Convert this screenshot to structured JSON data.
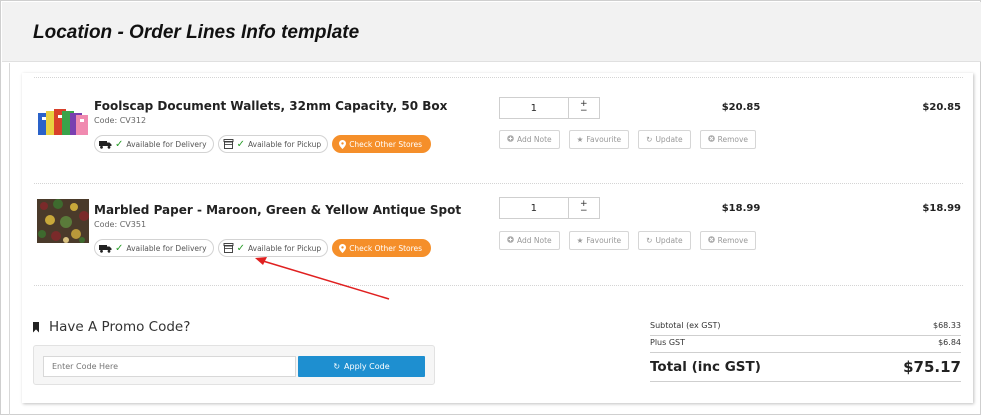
{
  "page": {
    "title": "Location - Order Lines Info template"
  },
  "colors": {
    "accent_orange": "#f58f2a",
    "apply_blue": "#1e8fd0",
    "tick_green": "#2a9d2a",
    "annotation_red": "#e02020"
  },
  "order_lines": [
    {
      "name": "Foolscap Document Wallets, 32mm Capacity, 50 Box",
      "code": "Code: CV312",
      "thumb_icon": "document-wallets-image",
      "delivery_label": "Available for Delivery",
      "pickup_label": "Available for Pickup",
      "stores_label": "Check Other Stores",
      "quantity": "1",
      "unit_price": "$20.85",
      "line_total": "$20.85",
      "actions": {
        "add_note": "Add Note",
        "favourite": "Favourite",
        "update": "Update",
        "remove": "Remove"
      }
    },
    {
      "name": "Marbled Paper - Maroon, Green & Yellow Antique Spot",
      "code": "Code: CV351",
      "thumb_icon": "marbled-paper-image",
      "delivery_label": "Available for Delivery",
      "pickup_label": "Available for Pickup",
      "stores_label": "Check Other Stores",
      "quantity": "1",
      "unit_price": "$18.99",
      "line_total": "$18.99",
      "actions": {
        "add_note": "Add Note",
        "favourite": "Favourite",
        "update": "Update",
        "remove": "Remove"
      }
    }
  ],
  "promo": {
    "title": "Have A Promo Code?",
    "placeholder": "Enter Code Here",
    "apply_label": "Apply Code"
  },
  "summary": {
    "subtotal_label": "Subtotal (ex GST)",
    "subtotal_value": "$68.33",
    "gst_label": "Plus GST",
    "gst_value": "$6.84",
    "total_label": "Total (inc GST)",
    "total_value": "$75.17"
  }
}
